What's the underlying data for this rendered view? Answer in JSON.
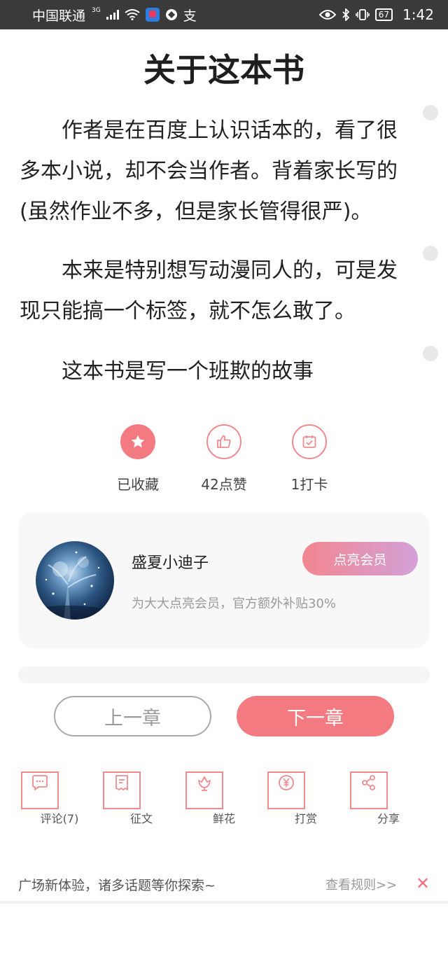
{
  "status_bar": {
    "carrier": "中国联通",
    "network_sup": "3G",
    "extra_glyph": "支",
    "battery": "67",
    "time": "1:42"
  },
  "title": "关于这本书",
  "paragraphs": [
    "作者是在百度上认识话本的，看了很多本小说，却不会当作者。背着家长写的(虽然作业不多，但是家长管得很严)。",
    "本来是特别想写动漫同人的，可是发现只能搞一个标签，就不怎么敢了。",
    "这本书是写一个班欺的故事"
  ],
  "actions": {
    "collect": {
      "label": "已收藏",
      "icon": "star-icon"
    },
    "like": {
      "label": "42点赞",
      "icon": "thumbs-up-icon"
    },
    "checkin": {
      "label": "1打卡",
      "icon": "calendar-check-icon"
    }
  },
  "member_card": {
    "name": "盛夏小迪子",
    "subtitle": "为大大点亮会员，官方额外补贴30%",
    "button_label": "点亮会员"
  },
  "nav": {
    "prev_label": "上一章",
    "next_label": "下一章"
  },
  "tools": {
    "comment": {
      "label": "评论(7)",
      "icon": "comment-icon"
    },
    "contest": {
      "label": "征文",
      "icon": "document-icon"
    },
    "flower": {
      "label": "鲜花",
      "icon": "flower-icon"
    },
    "reward": {
      "label": "打赏",
      "icon": "yen-icon"
    },
    "share": {
      "label": "分享",
      "icon": "share-icon"
    }
  },
  "notice": {
    "text": "广场新体验，诸多话题等你探索~",
    "link": "查看规则>>",
    "close": "✕"
  },
  "colors": {
    "accent": "#f27a80",
    "accent_outline": "#f08a8e",
    "member_gradient_end": "#d3a1d8"
  }
}
